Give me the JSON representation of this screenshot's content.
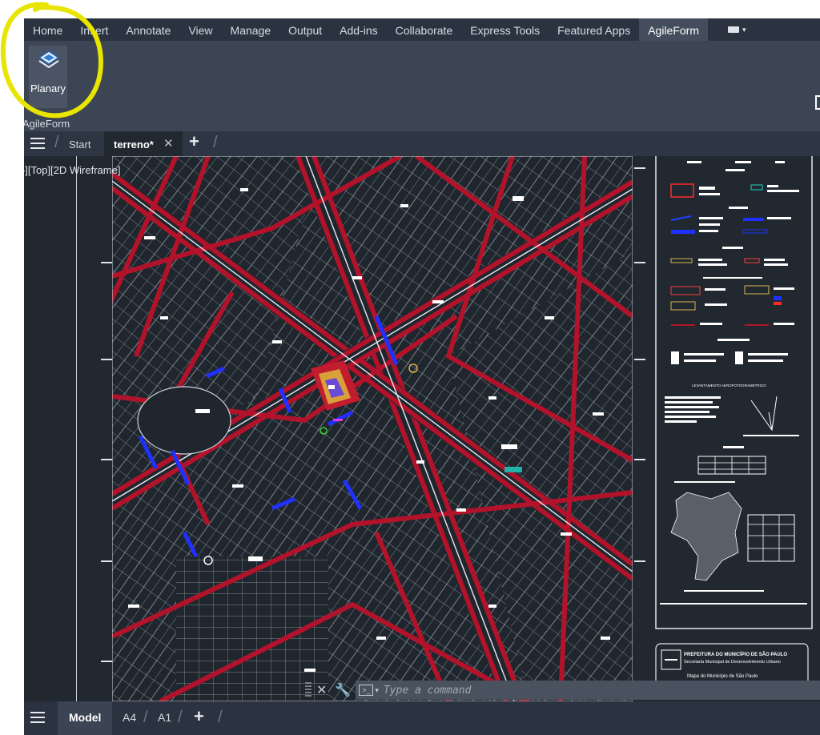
{
  "ribbon": {
    "tabs": [
      "Home",
      "Insert",
      "Annotate",
      "View",
      "Manage",
      "Output",
      "Add-ins",
      "Collaborate",
      "Express Tools",
      "Featured Apps",
      "AgileForm"
    ],
    "active_tab": "AgileForm",
    "panel": {
      "button_label": "Planary",
      "button_icon": "planary-diamond-icon",
      "panel_title": "AgileForm"
    }
  },
  "file_tabs": {
    "start_label": "Start",
    "active_label": "terreno*"
  },
  "viewport": {
    "label": "–][Top][2D Wireframe]"
  },
  "drawing": {
    "title_block_line1": "PREFEITURA DO MUNICÍPIO DE SÃO PAULO",
    "title_block_line2": "Secretaria Municipal de Desenvolvimento Urbano",
    "title_block_line3": "Mapa do Município de São Paulo",
    "legend_heading": "LEVANTAMENTO AEROFOTOGRAMÉTRICO"
  },
  "command_line": {
    "placeholder": "Type a command"
  },
  "layout_tabs": [
    "Model",
    "A4",
    "A1"
  ],
  "colors": {
    "background": "#212830",
    "ribbon": "#3c4554",
    "roads": "#b3132a",
    "annotation": "#e8e500"
  }
}
